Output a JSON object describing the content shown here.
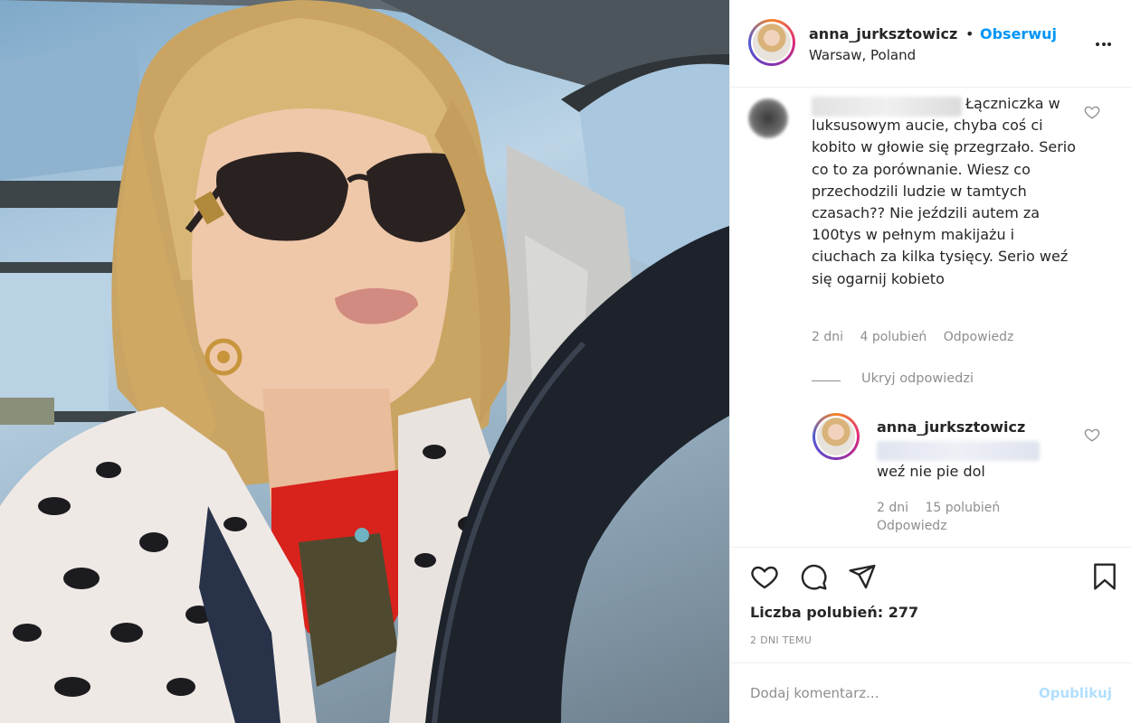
{
  "post": {
    "author": "anna_jurksztowicz",
    "separator": "•",
    "follow_label": "Obserwuj",
    "location": "Warsaw, Poland"
  },
  "comment": {
    "text": "Łączniczka w luksusowym aucie, chyba coś ci kobito w głowie się przegrzało. Serio co to za porównanie. Wiesz co przechodzili ludzie w tamtych czasach?? Nie jeździli autem za 100tys w pełnym makijażu i ciuchach za kilka tysięcy. Serio weź się ogarnij kobieto",
    "age": "2 dni",
    "likes": "4 polubień",
    "reply_label": "Odpowiedz"
  },
  "hide_replies_label": "Ukryj odpowiedzi",
  "reply": {
    "author": "anna_jurksztowicz",
    "text": "weź nie pie  dol",
    "age": "2 dni",
    "likes": "15 polubień",
    "reply_label": "Odpowiedz"
  },
  "actions": {
    "icons": [
      "heart-icon",
      "comment-icon",
      "share-icon",
      "bookmark-icon"
    ]
  },
  "likes_label": "Liczba polubień: 277",
  "timestamp": "2 DNI TEMU",
  "add_comment": {
    "placeholder": "Dodaj komentarz...",
    "post_label": "Opublikuj"
  },
  "colors": {
    "link_blue": "#0095f6",
    "post_button_disabled": "#b2dffc",
    "secondary_text": "#8e8e8e"
  }
}
